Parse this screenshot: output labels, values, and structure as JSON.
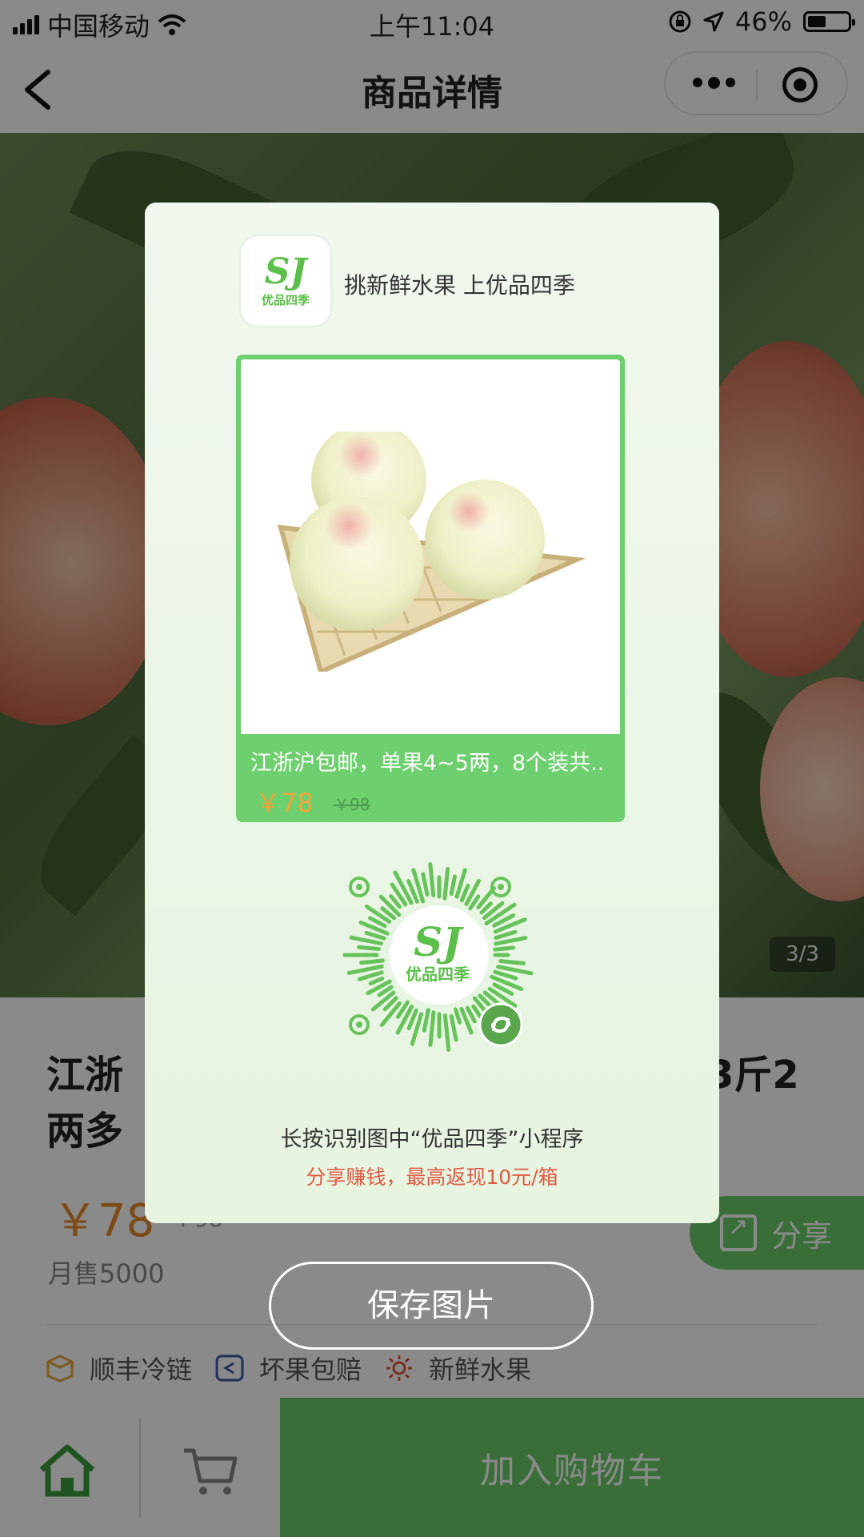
{
  "status_bar": {
    "carrier": "中国移动",
    "time": "上午11:04",
    "battery": "46%",
    "battery_level": 0.46
  },
  "nav": {
    "title": "商品详情"
  },
  "gallery": {
    "counter": "3/3"
  },
  "product": {
    "name": "江浙沪包邮，单果4~5两，8个装共3斤2两多",
    "name_visible_start": "江浙",
    "name_visible_end": "3斤2",
    "name_line2": "两多",
    "price": "￥78",
    "old_price": "￥98",
    "sales": "月售5000",
    "share_label": "分享",
    "tags": [
      "顺丰冷链",
      "坏果包赔",
      "新鲜水果"
    ]
  },
  "bottom_bar": {
    "add_to_cart": "加入购物车"
  },
  "poster": {
    "brand_mark": "SJ",
    "brand_name": "优品四季",
    "slogan": "挑新鲜水果 上优品四季",
    "product_title": "江浙沪包邮，单果4~5两，8个装共..",
    "product_price": "￥78",
    "product_old_price": "￥98",
    "qr_caption": "长按识别图中“优品四季”小程序",
    "qr_sub": "分享赚钱，最高返现10元/箱"
  },
  "actions": {
    "save_image": "保存图片"
  },
  "colors": {
    "accent_green": "#6acb6a",
    "price_orange": "#e6892a",
    "promo_red": "#e05a44"
  }
}
